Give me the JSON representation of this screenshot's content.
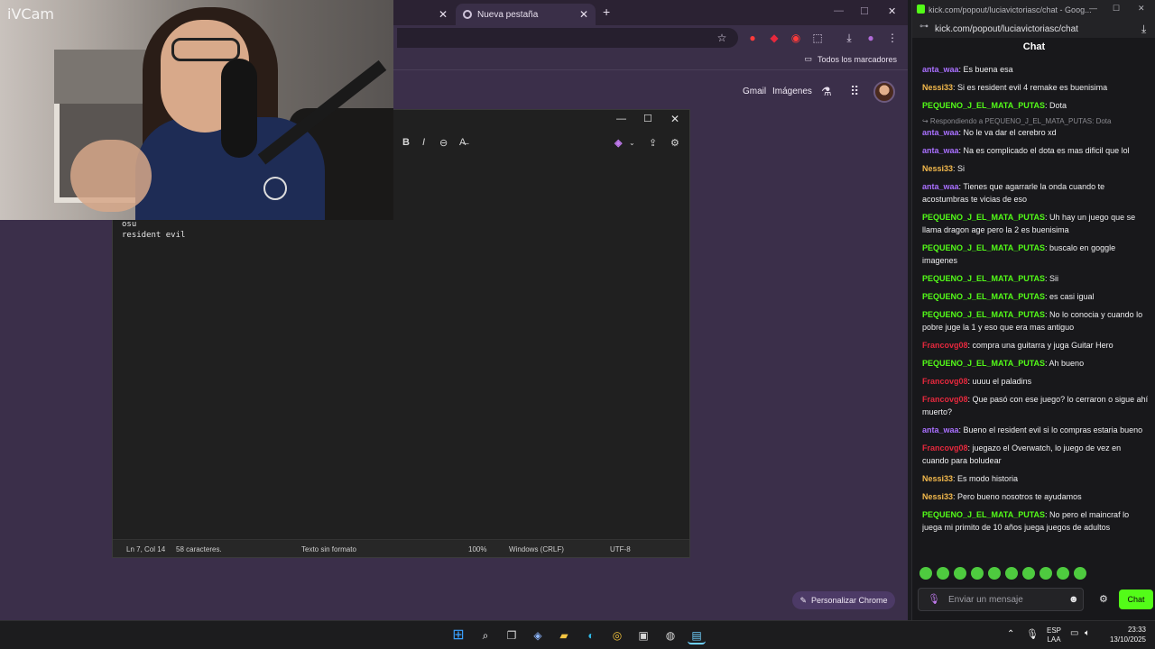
{
  "browser": {
    "tabs": [
      {
        "label": ""
      },
      {
        "label": "Nueva pestaña"
      }
    ],
    "bookmarks_all": "Todos los marcadores",
    "gmail": "Gmail",
    "images": "Imágenes",
    "customize": "Personalizar Chrome"
  },
  "notepad": {
    "text": "osu\nresident evil",
    "status": {
      "position": "Ln 7, Col 14",
      "chars": "58 caracteres.",
      "format": "Texto sin formato",
      "zoom": "100%",
      "eol": "Windows (CRLF)",
      "encoding": "UTF-8"
    }
  },
  "webcam": {
    "label": "iVCam"
  },
  "chat": {
    "window_title": "kick.com/popout/luciavictoriasc/chat - Goog...",
    "url": "kick.com/popout/luciavictoriasc/chat",
    "header": "Chat",
    "input_placeholder": "Enviar un mensaje",
    "send_label": "Chat",
    "user_colors": {
      "anta_waa": "#a970ff",
      "Nessi33": "#f3b94c",
      "PEQUENO_J_EL_MATA_PUTAS": "#53fc18",
      "Francovg08": "#e6283d"
    },
    "messages": [
      {
        "user": "anta_waa",
        "text": "Es buena esa"
      },
      {
        "user": "Nessi33",
        "text": "Si es resident evil 4 remake es buenisima"
      },
      {
        "user": "PEQUENO_J_EL_MATA_PUTAS",
        "text": "Dota"
      },
      {
        "reply": "Respondiendo a PEQUENO_J_EL_MATA_PUTAS: Dota",
        "user": "anta_waa",
        "text": "No le va dar el cerebro xd"
      },
      {
        "user": "anta_waa",
        "text": "Na es complicado el dota es mas dificil que lol"
      },
      {
        "user": "Nessi33",
        "text": "Si"
      },
      {
        "user": "anta_waa",
        "text": "Tienes que agarrarle la onda cuando te acostumbras te vicias de eso"
      },
      {
        "user": "PEQUENO_J_EL_MATA_PUTAS",
        "text": "Uh hay un juego que se llama dragon age pero la 2 es buenisima"
      },
      {
        "user": "PEQUENO_J_EL_MATA_PUTAS",
        "text": "buscalo en goggle imagenes"
      },
      {
        "user": "PEQUENO_J_EL_MATA_PUTAS",
        "text": "Sii"
      },
      {
        "user": "PEQUENO_J_EL_MATA_PUTAS",
        "text": "es casi igual"
      },
      {
        "user": "PEQUENO_J_EL_MATA_PUTAS",
        "text": "No lo conocia y cuando lo pobre juge la 1 y eso que era mas antiguo"
      },
      {
        "user": "Francovg08",
        "text": "compra una guitarra y juga Guitar Hero"
      },
      {
        "user": "PEQUENO_J_EL_MATA_PUTAS",
        "text": "Ah bueno"
      },
      {
        "user": "Francovg08",
        "text": "uuuu el paladins"
      },
      {
        "user": "Francovg08",
        "text": "Que pasó con ese juego? lo cerraron o sigue ahí muerto?"
      },
      {
        "user": "anta_waa",
        "text": "Bueno el resident evil si lo compras estaria bueno"
      },
      {
        "user": "Francovg08",
        "text": "juegazo el Overwatch, lo juego de vez en cuando para boludear"
      },
      {
        "user": "Nessi33",
        "text": "Es modo historia"
      },
      {
        "user": "Nessi33",
        "text": "Pero bueno nosotros te ayudamos"
      },
      {
        "user": "PEQUENO_J_EL_MATA_PUTAS",
        "text": "No pero el maincraf lo juega mi primito de 10 años juega juegos de adultos"
      }
    ]
  },
  "taskbar": {
    "lang": "ESP",
    "layout": "LAA",
    "time": "23:33",
    "date": "13/10/2025"
  }
}
